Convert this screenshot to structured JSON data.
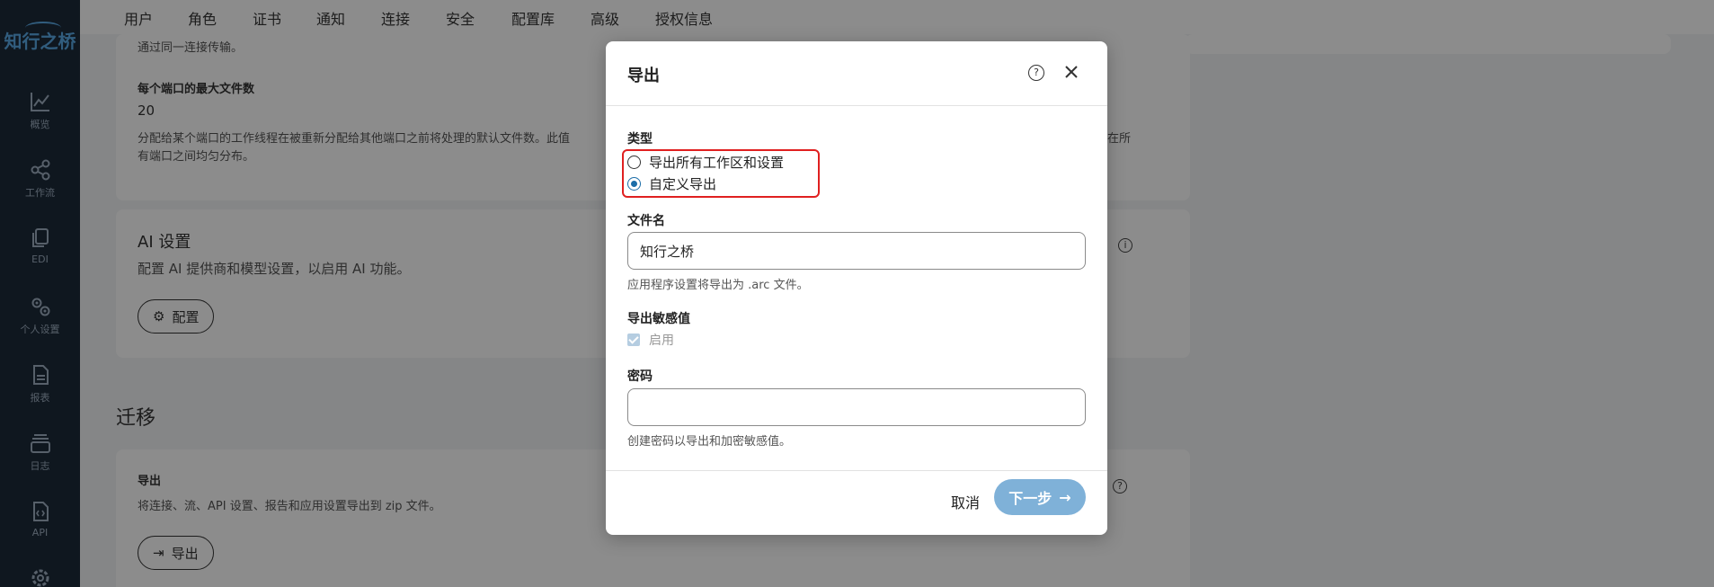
{
  "sidebar": {
    "logo": "知行之桥",
    "items": [
      {
        "label": "概览",
        "icon": "chart-line-icon"
      },
      {
        "label": "工作流",
        "icon": "share-nodes-icon"
      },
      {
        "label": "EDI",
        "icon": "documents-icon"
      },
      {
        "label": "个人设置",
        "icon": "gears-icon"
      },
      {
        "label": "报表",
        "icon": "report-icon"
      },
      {
        "label": "日志",
        "icon": "layers-icon"
      },
      {
        "label": "API",
        "icon": "code-file-icon"
      }
    ]
  },
  "tabs": [
    {
      "label": "用户"
    },
    {
      "label": "角色"
    },
    {
      "label": "证书"
    },
    {
      "label": "通知"
    },
    {
      "label": "连接"
    },
    {
      "label": "安全"
    },
    {
      "label": "配置库"
    },
    {
      "label": "高级",
      "active": true
    },
    {
      "label": "授权信息"
    }
  ],
  "background": {
    "top_text": "通过同一连接传输。",
    "max_files_label": "每个端口的最大文件数",
    "max_files_value": "20",
    "max_files_desc_left": "分配给某个端口的工作线程在被重新分配给其他端口之前将处理的默认文件数。此值",
    "max_files_desc_right": "在所",
    "max_files_desc_line2": "有端口之间均匀分布。",
    "ai_title": "AI 设置",
    "ai_desc": "配置 AI 提供商和模型设置，以启用 AI 功能。",
    "ai_button": "配置",
    "migration_title": "迁移",
    "export_label": "导出",
    "export_desc": "将连接、流、API 设置、报告和应用设置导出到 zip 文件。",
    "export_button": "导出"
  },
  "modal": {
    "title": "导出",
    "type_label": "类型",
    "option_all": "导出所有工作区和设置",
    "option_custom": "自定义导出",
    "selected_option": "自定义导出",
    "filename_label": "文件名",
    "filename_value": "知行之桥",
    "filename_help": "应用程序设置将导出为 .arc 文件。",
    "sensitive_label": "导出敏感值",
    "sensitive_checkbox": "启用",
    "password_label": "密码",
    "password_value": "",
    "password_help": "创建密码以导出和加密敏感值。",
    "cancel_button": "取消",
    "next_button": "下一步"
  }
}
